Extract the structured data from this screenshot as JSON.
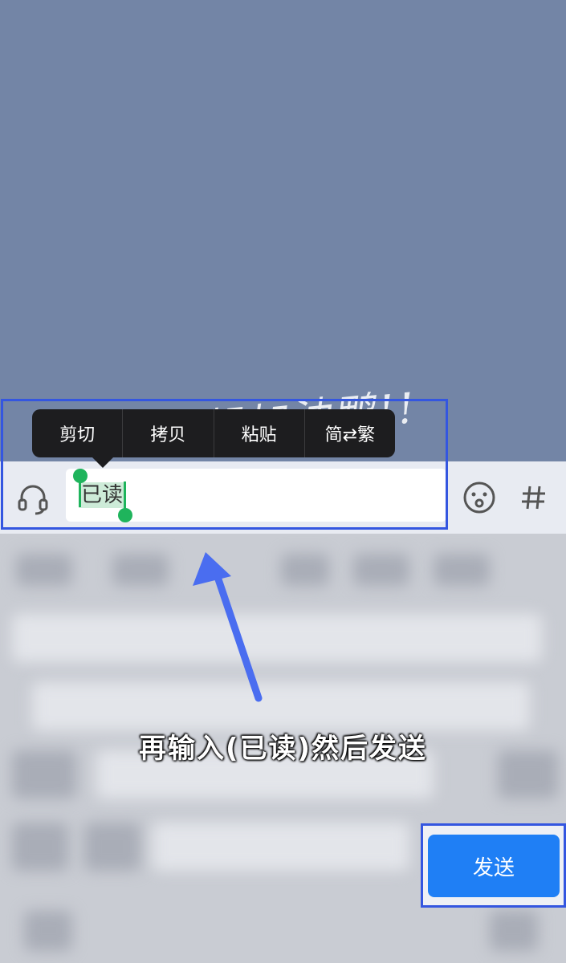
{
  "chat": {
    "watermark_text": "一起加油鸭!!"
  },
  "input_bar": {
    "voice_icon": "headset-icon",
    "text_value": "已读",
    "emoji_icon": "emoji-icon",
    "hash_icon": "hash-icon"
  },
  "context_menu": {
    "items": [
      {
        "label": "剪切"
      },
      {
        "label": "拷贝"
      },
      {
        "label": "粘贴"
      },
      {
        "label": "简⇄繁"
      }
    ]
  },
  "annotation": {
    "instruction": "再输入(已读)然后发送",
    "highlight_color": "#3456e0"
  },
  "keyboard": {
    "send_label": "发送"
  },
  "colors": {
    "chat_background": "#7385a6",
    "selection_handle": "#1fb45c",
    "send_button": "#1f7ff5"
  }
}
